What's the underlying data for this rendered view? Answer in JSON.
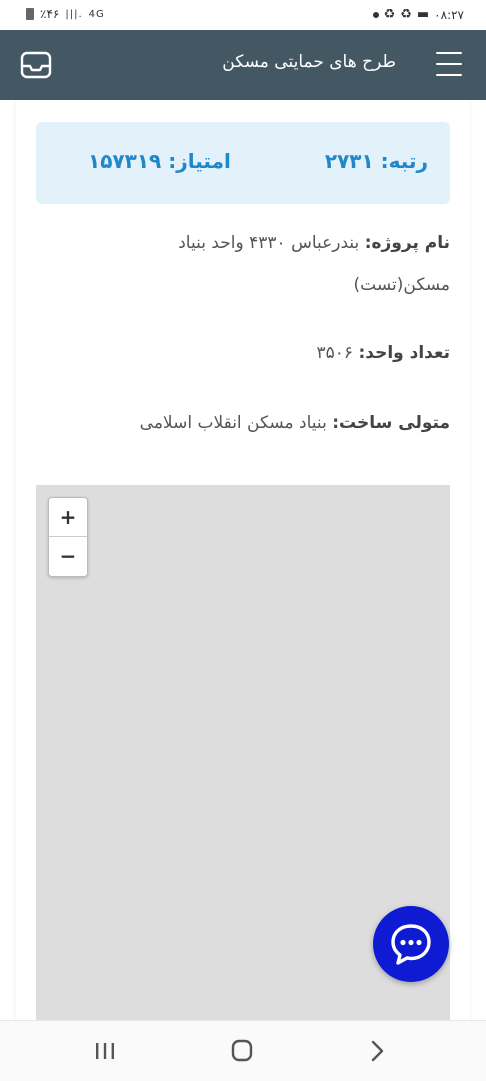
{
  "status_bar": {
    "battery": "٪۴۶",
    "network": "4G",
    "time": "۰۸:۲۷"
  },
  "app_bar": {
    "title": "طرح های حمایتی مسکن",
    "menu_icon": "hamburger-menu-icon",
    "inbox_icon": "inbox-tray-icon",
    "background": "#445863"
  },
  "project": {
    "rank_label": "رتبه: ۲۷۳۱",
    "score_label": "امتیاز: ۱۵۷۳۱۹",
    "name_label": "نام پروژه:",
    "name_value": "بندرعباس ۴۳۳۰ واحد بنیاد مسکن(تست)",
    "units_label": "تعداد واحد:",
    "units_value": "۳۵۰۶",
    "builder_label": "متولی ساخت:",
    "builder_value": "بنیاد مسکن انقلاب اسلامی",
    "accent": "#1e88c8",
    "card_bg": "#e3f1fb"
  },
  "map": {
    "zoom_in": "+",
    "zoom_out": "−"
  },
  "chat_button": {
    "icon": "chat-bubble-icon",
    "color": "#0e1bd3"
  },
  "nav_bar": {
    "recent_icon": "recent-apps-icon",
    "home_icon": "home-icon",
    "back_icon": "back-chevron-icon"
  }
}
